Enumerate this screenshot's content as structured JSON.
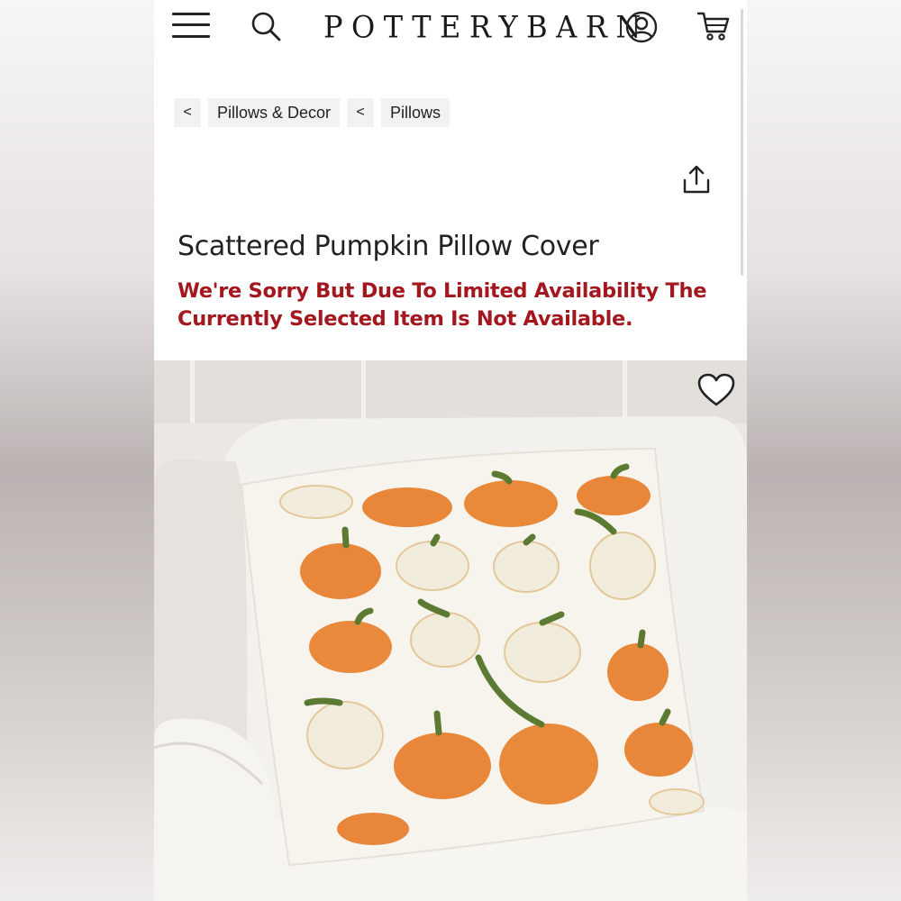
{
  "header": {
    "logo_text": "POTTERYBARN",
    "icons": [
      "menu-icon",
      "search-icon",
      "account-icon",
      "cart-icon"
    ]
  },
  "breadcrumb": {
    "back_symbol": "<",
    "items": [
      "Pillows & Decor",
      "Pillows"
    ]
  },
  "product": {
    "title": "Scattered Pumpkin Pillow Cover",
    "availability_message": "We're Sorry But Due To Limited Availability The Currently Selected Item Is Not Available."
  },
  "colors": {
    "alert_red": "#a3171e",
    "text_dark": "#222222",
    "crumb_bg": "#f2f2f2"
  },
  "icons": [
    "share-icon",
    "heart-icon"
  ]
}
